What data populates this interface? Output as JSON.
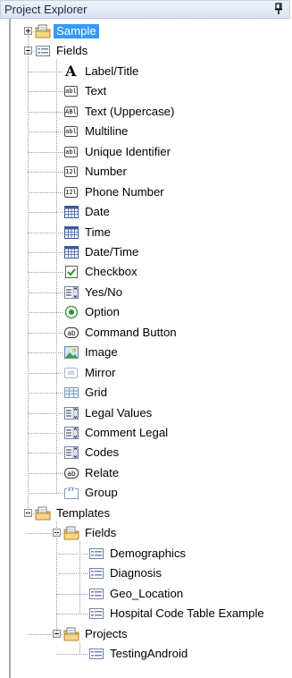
{
  "panel": {
    "title": "Project Explorer",
    "pin_icon": "pin-icon"
  },
  "tree": [
    {
      "label": "Sample",
      "icon": "folder-database-icon",
      "depth": 0,
      "expander": "plus",
      "selected": true
    },
    {
      "label": "Fields",
      "icon": "form-icon",
      "depth": 0,
      "expander": "minus"
    },
    {
      "label": "Label/Title",
      "icon": "label-icon",
      "depth": 1
    },
    {
      "label": "Text",
      "icon": "text-field-icon",
      "depth": 1
    },
    {
      "label": "Text (Uppercase)",
      "icon": "uppercase-text-icon",
      "depth": 1
    },
    {
      "label": "Multiline",
      "icon": "multiline-icon",
      "depth": 1
    },
    {
      "label": "Unique Identifier",
      "icon": "unique-id-icon",
      "depth": 1
    },
    {
      "label": "Number",
      "icon": "number-icon",
      "depth": 1
    },
    {
      "label": "Phone Number",
      "icon": "phone-number-icon",
      "depth": 1
    },
    {
      "label": "Date",
      "icon": "calendar-icon",
      "depth": 1
    },
    {
      "label": "Time",
      "icon": "calendar-icon",
      "depth": 1
    },
    {
      "label": "Date/Time",
      "icon": "calendar-icon",
      "depth": 1
    },
    {
      "label": "Checkbox",
      "icon": "checkbox-icon",
      "depth": 1
    },
    {
      "label": "Yes/No",
      "icon": "dropdown-list-icon",
      "depth": 1
    },
    {
      "label": "Option",
      "icon": "radio-option-icon",
      "depth": 1
    },
    {
      "label": "Command Button",
      "icon": "command-button-icon",
      "depth": 1
    },
    {
      "label": "Image",
      "icon": "image-icon",
      "depth": 1
    },
    {
      "label": "Mirror",
      "icon": "mirror-icon",
      "depth": 1
    },
    {
      "label": "Grid",
      "icon": "grid-icon",
      "depth": 1
    },
    {
      "label": "Legal Values",
      "icon": "dropdown-list-icon",
      "depth": 1
    },
    {
      "label": "Comment Legal",
      "icon": "dropdown-list-icon",
      "depth": 1
    },
    {
      "label": "Codes",
      "icon": "dropdown-list-icon",
      "depth": 1
    },
    {
      "label": "Relate",
      "icon": "relate-icon",
      "depth": 1
    },
    {
      "label": "Group",
      "icon": "group-icon",
      "depth": 1
    },
    {
      "label": "Templates",
      "icon": "folder-database-icon",
      "depth": 0,
      "expander": "minus"
    },
    {
      "label": "Fields",
      "icon": "folder-database-icon",
      "depth": 1,
      "expander": "minus"
    },
    {
      "label": "Demographics",
      "icon": "form-icon",
      "depth": 2
    },
    {
      "label": "Diagnosis",
      "icon": "form-icon",
      "depth": 2
    },
    {
      "label": "Geo_Location",
      "icon": "form-icon",
      "depth": 2
    },
    {
      "label": "Hospital Code Table Example",
      "icon": "form-icon",
      "depth": 2
    },
    {
      "label": "Projects",
      "icon": "folder-database-icon",
      "depth": 1,
      "expander": "minus"
    },
    {
      "label": "TestingAndroid",
      "icon": "form-icon",
      "depth": 2
    }
  ],
  "glyphs": {
    "text": "abl",
    "uppercase": "ABl",
    "number": "12l",
    "button": "ab",
    "label": "A",
    "group": "XY"
  },
  "colors": {
    "selection": "#3399ff",
    "folder": "#f0c75e",
    "check": "#1f9a1f"
  }
}
